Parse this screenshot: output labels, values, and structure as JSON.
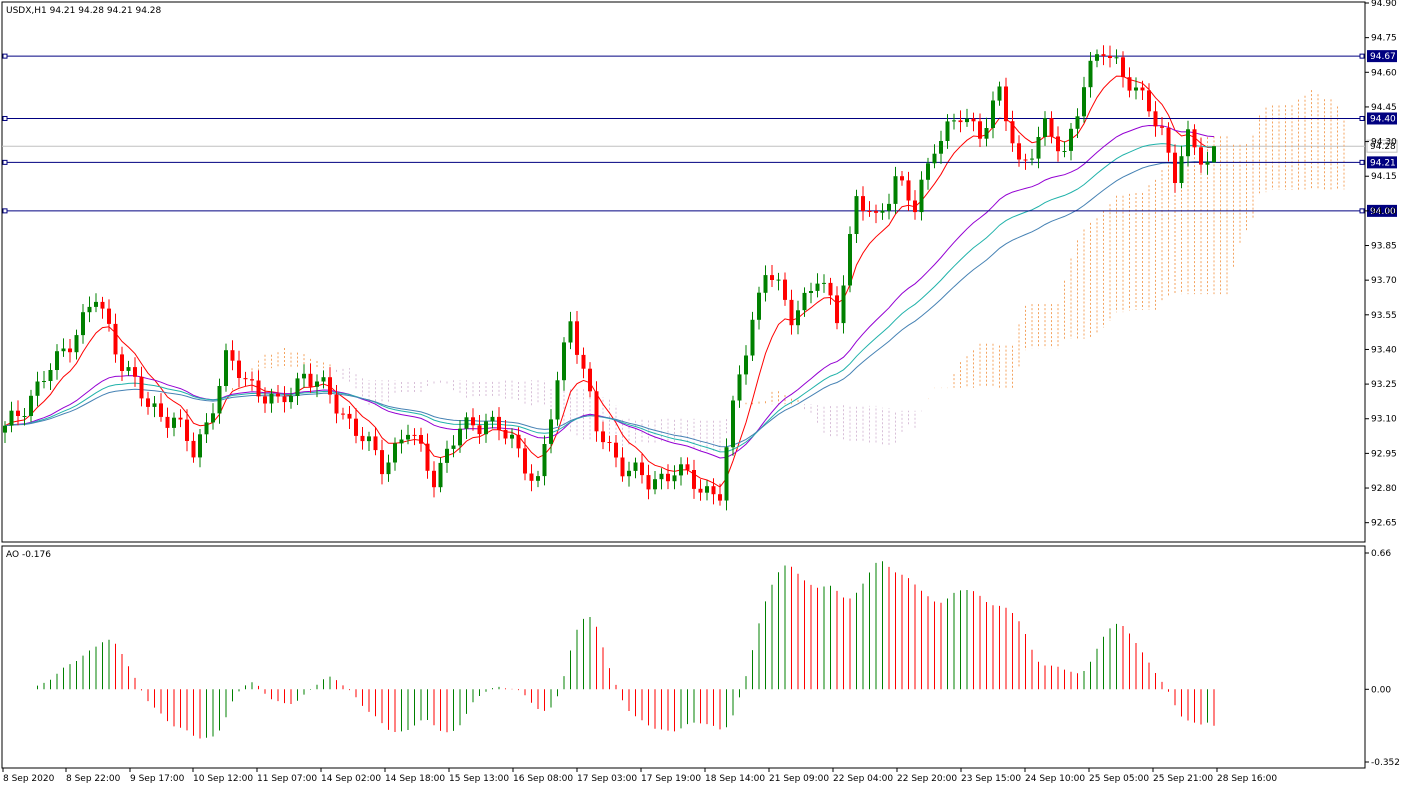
{
  "chart_data": [
    {
      "type": "candlestick",
      "title": "USDX,H1  94.21 94.28 94.21 94.28",
      "symbol": "USDX",
      "timeframe": "H1",
      "last_ohlc": {
        "open": 94.21,
        "high": 94.28,
        "low": 94.21,
        "close": 94.28
      },
      "ylim": [
        92.575,
        94.9
      ],
      "y_ticks": [
        "94.90",
        "94.75",
        "94.60",
        "94.45",
        "94.30",
        "94.15",
        "94.00",
        "93.85",
        "93.70",
        "93.55",
        "93.40",
        "93.25",
        "93.10",
        "92.95",
        "92.80",
        "92.65"
      ],
      "x_ticks": [
        "8 Sep 2020",
        "8 Sep 22:00",
        "9 Sep 17:00",
        "10 Sep 12:00",
        "11 Sep 07:00",
        "14 Sep 02:00",
        "14 Sep 18:00",
        "15 Sep 13:00",
        "16 Sep 08:00",
        "17 Sep 03:00",
        "17 Sep 19:00",
        "18 Sep 14:00",
        "21 Sep 09:00",
        "22 Sep 04:00",
        "22 Sep 20:00",
        "23 Sep 15:00",
        "24 Sep 10:00",
        "25 Sep 05:00",
        "25 Sep 21:00",
        "28 Sep 16:00"
      ],
      "horizontal_levels": [
        {
          "value": 94.67,
          "label": "94.67"
        },
        {
          "value": 94.4,
          "label": "94.40"
        },
        {
          "value": 94.21,
          "label": "94.21"
        },
        {
          "value": 94.0,
          "label": "94.00"
        }
      ],
      "price_tag": {
        "value": 94.28,
        "label": "94.28"
      },
      "anchors": [
        [
          0,
          93.05
        ],
        [
          8,
          93.35
        ],
        [
          14,
          93.62
        ],
        [
          18,
          93.35
        ],
        [
          22,
          93.15
        ],
        [
          26,
          93.1
        ],
        [
          29,
          92.95
        ],
        [
          31,
          93.08
        ],
        [
          34,
          93.35
        ],
        [
          38,
          93.25
        ],
        [
          42,
          93.15
        ],
        [
          46,
          93.3
        ],
        [
          50,
          93.2
        ],
        [
          54,
          93.05
        ],
        [
          58,
          92.9
        ],
        [
          62,
          93.05
        ],
        [
          66,
          92.85
        ],
        [
          70,
          93.05
        ],
        [
          74,
          93.1
        ],
        [
          78,
          93.0
        ],
        [
          82,
          92.82
        ],
        [
          87,
          93.55
        ],
        [
          91,
          93.05
        ],
        [
          95,
          92.9
        ],
        [
          99,
          92.82
        ],
        [
          103,
          92.88
        ],
        [
          107,
          92.8
        ],
        [
          110,
          92.78
        ],
        [
          113,
          93.3
        ],
        [
          117,
          93.75
        ],
        [
          121,
          93.55
        ],
        [
          125,
          93.7
        ],
        [
          128,
          93.55
        ],
        [
          131,
          94.05
        ],
        [
          134,
          93.95
        ],
        [
          137,
          94.15
        ],
        [
          140,
          94.0
        ],
        [
          143,
          94.3
        ],
        [
          147,
          94.4
        ],
        [
          150,
          94.35
        ],
        [
          153,
          94.5
        ],
        [
          156,
          94.2
        ],
        [
          160,
          94.35
        ],
        [
          163,
          94.25
        ],
        [
          166,
          94.55
        ],
        [
          169,
          94.7
        ],
        [
          171,
          94.65
        ],
        [
          174,
          94.5
        ],
        [
          176,
          94.45
        ],
        [
          178,
          94.35
        ],
        [
          180,
          94.15
        ],
        [
          182,
          94.3
        ],
        [
          185,
          94.22
        ],
        [
          186,
          94.28
        ]
      ]
    },
    {
      "type": "bar",
      "title": "AO -0.176",
      "indicator": "AO",
      "last_value": -0.176,
      "ylim": [
        -0.352,
        0.66
      ],
      "y_ticks": [
        "0.66",
        "0.00",
        "-0.352"
      ],
      "colors": {
        "up": "#008000",
        "down": "#ff0000"
      }
    }
  ],
  "colors": {
    "bull": "#008000",
    "bear": "#ff0000",
    "level": "#000080",
    "ma_fast": "#ff0000",
    "ma_mid": "#9400d3",
    "ma_teal": "#20b2aa",
    "ma_steel": "#4682b4",
    "cloud_up": "#f4a460",
    "cloud_down": "#d8bfd8"
  }
}
